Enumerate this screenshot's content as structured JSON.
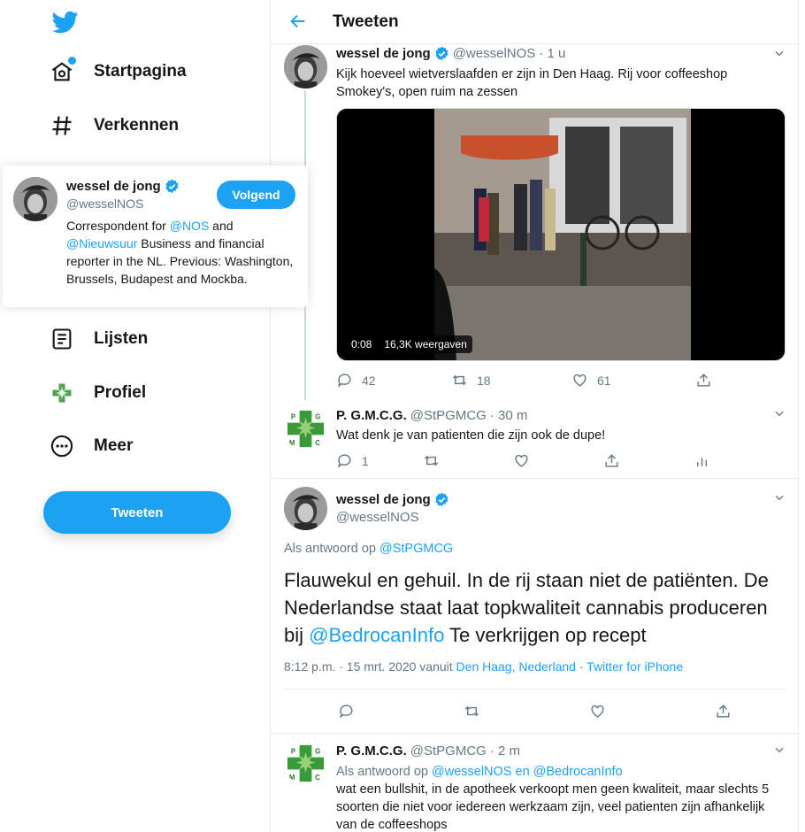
{
  "sidebar": {
    "nav": [
      {
        "label": "Startpagina",
        "icon": "home-icon"
      },
      {
        "label": "Verkennen",
        "icon": "hashtag-icon"
      },
      {
        "label": "Lijsten",
        "icon": "list-icon"
      },
      {
        "label": "Profiel",
        "icon": "profile-avatar-icon"
      },
      {
        "label": "Meer",
        "icon": "more-icon"
      }
    ],
    "tweet_button": "Tweeten"
  },
  "hover_card": {
    "name": "wessel de jong",
    "handle": "@wesselNOS",
    "follow_label": "Volgend",
    "bio_prefix": "Correspondent for ",
    "bio_link1": "@NOS",
    "bio_and": " and",
    "bio_link2": "@Nieuwsuur",
    "bio_suffix": " Business and financial reporter in the NL. Previous: Washington, Brussels, Budapest and Mockba."
  },
  "header": {
    "title": "Tweeten"
  },
  "tweets": [
    {
      "name": "wessel de jong",
      "handle": "@wesselNOS",
      "time": "· 1 u",
      "text_line1": "Kijk hoeveel wietverslaafden er zijn in Den Haag. Rij voor coffeeshop",
      "text_line2": "Smokey's, open ruim na zessen",
      "video_time": "0:08",
      "video_views": "16,3K weergaven",
      "replies": "42",
      "retweets": "18",
      "likes": "61"
    },
    {
      "name": "P. G.M.C.G.",
      "handle": "@StPGMCG",
      "time": "· 30 m",
      "text": "Wat denk je van patienten die zijn ook de dupe!",
      "replies": "1"
    },
    {
      "name": "wessel de jong",
      "handle": "@wesselNOS",
      "reply_prefix": "Als antwoord op ",
      "reply_to": "@StPGMCG",
      "text_part1": "Flauwekul en gehuil. In de rij staan niet de patiënten. De Nederlandse staat laat topkwaliteit cannabis produceren bij ",
      "text_link": "@BedrocanInfo",
      "text_part2": " Te verkrijgen op recept",
      "meta_time": "8:12 p.m. · 15 mrt. 2020 vanuit ",
      "meta_location": "Den Haag, Nederland",
      "meta_sep": " · ",
      "meta_source": "Twitter for iPhone"
    },
    {
      "name": "P. G.M.C.G.",
      "handle": "@StPGMCG",
      "time": "· 2 m",
      "reply_prefix": "Als antwoord op ",
      "reply_to": "@wesselNOS en @BedrocanInfo",
      "text_line1": "wat een bullshit, in de apotheek verkoopt men geen kwaliteit, maar slechts 5",
      "text_line2": "soorten die niet voor iedereen werkzaam zijn, veel patienten zijn afhankelijk",
      "text_line3": "van de coffeeshops"
    }
  ],
  "colors": {
    "accent": "#1da1f2",
    "secondary_text": "#657786",
    "border": "#e6ecf0"
  }
}
